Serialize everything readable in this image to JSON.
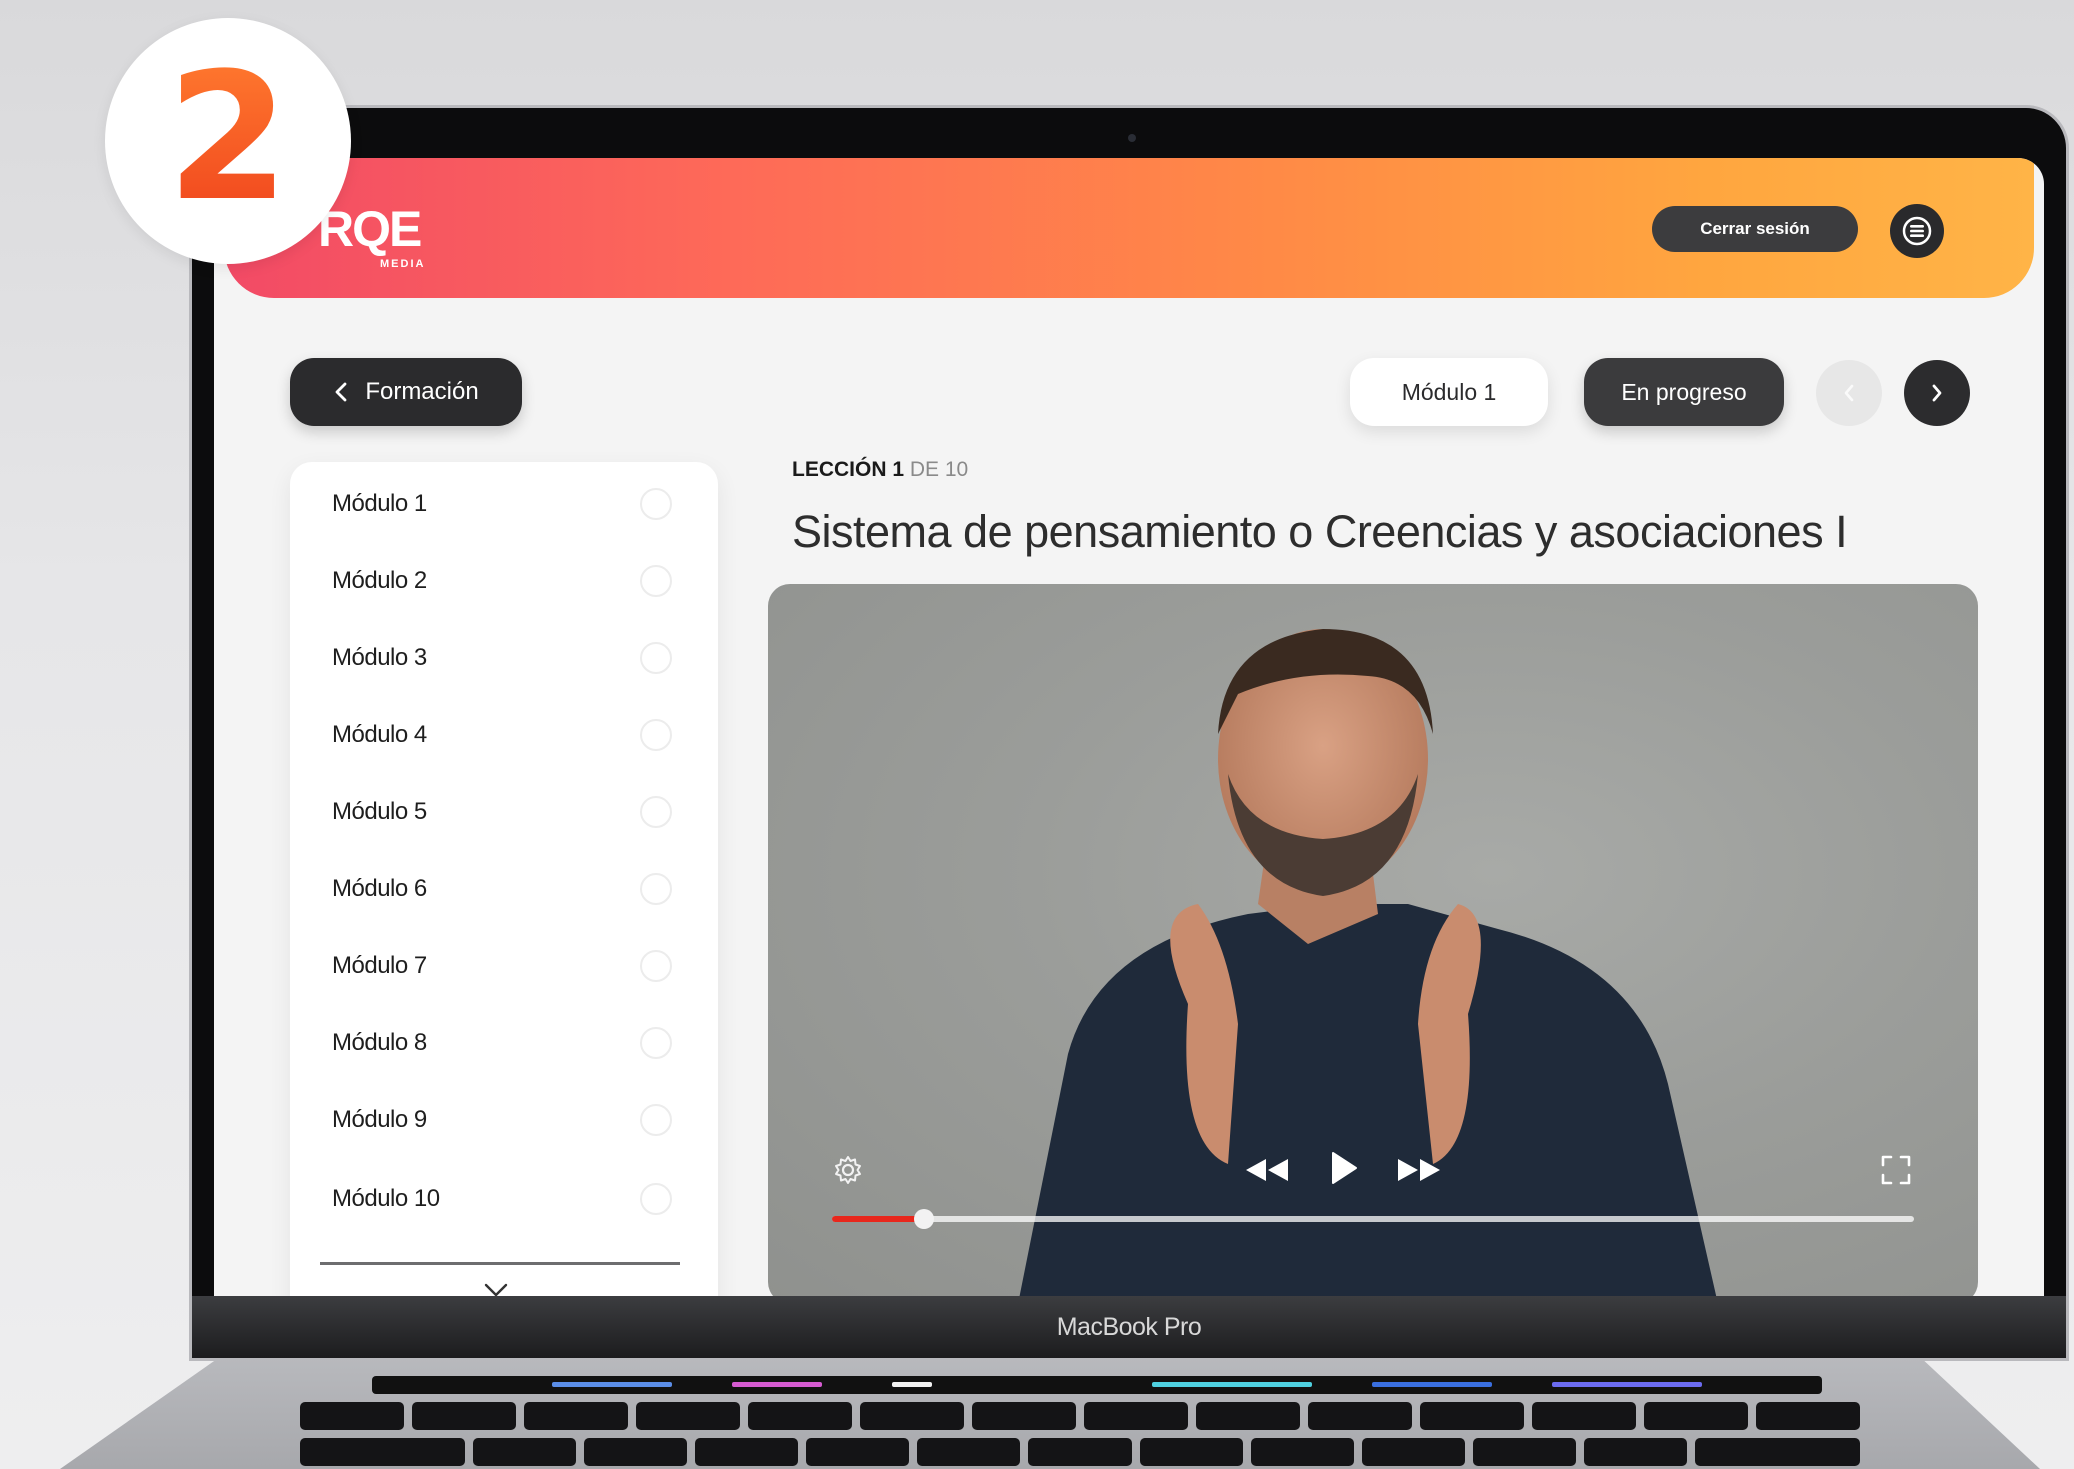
{
  "badge": {
    "number": "2"
  },
  "device": {
    "label": "MacBook Pro"
  },
  "header": {
    "logo_text": "RQE",
    "logo_subtext": "MEDIA",
    "logout_label": "Cerrar sesión",
    "menu_icon": "hamburger-menu-icon"
  },
  "nav": {
    "back_label": "Formación",
    "module_chip": "Módulo 1",
    "status_chip": "En progreso",
    "prev_icon": "chevron-left-icon",
    "next_icon": "chevron-right-icon"
  },
  "sidebar": {
    "items": [
      {
        "label": "Módulo 1"
      },
      {
        "label": "Módulo 2"
      },
      {
        "label": "Módulo 3"
      },
      {
        "label": "Módulo 4"
      },
      {
        "label": "Módulo 5"
      },
      {
        "label": "Módulo 6"
      },
      {
        "label": "Módulo 7"
      },
      {
        "label": "Módulo 8"
      },
      {
        "label": "Módulo 9"
      },
      {
        "label": "Módulo 10"
      }
    ],
    "expand_icon": "chevron-down-icon"
  },
  "lesson": {
    "label": "LECCIÓN 1",
    "of_label": "DE 10",
    "title": "Sistema de pensamiento o Creencias y asociaciones I"
  },
  "player": {
    "progress_fraction": 0.085,
    "settings_icon": "gear-icon",
    "rewind_icon": "rewind-icon",
    "play_icon": "play-icon",
    "forward_icon": "fast-forward-icon",
    "fullscreen_icon": "fullscreen-icon"
  },
  "colors": {
    "header_gradient_start": "#f24a66",
    "header_gradient_end": "#ffb447",
    "progress_accent": "#e8271c",
    "badge_accent": "#f0451d"
  }
}
